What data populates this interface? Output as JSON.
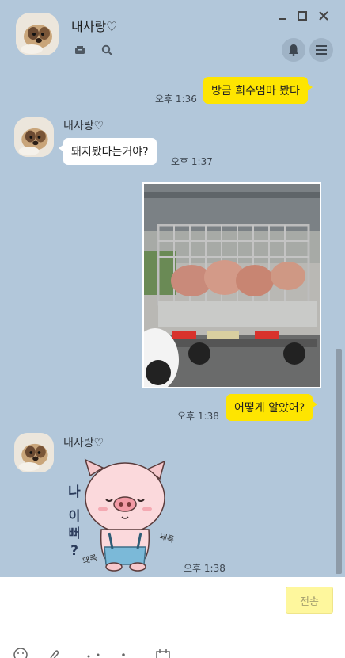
{
  "header": {
    "title": "내사랑♡",
    "window_controls": [
      "minimize-icon",
      "maximize-icon",
      "close-icon"
    ],
    "icons": [
      "drawer-icon",
      "search-icon",
      "bell-icon",
      "menu-icon"
    ]
  },
  "messages": [
    {
      "from": "me",
      "text": "방금 희수엄마 봤다",
      "time": "오후 1:36"
    },
    {
      "from": "them",
      "sender": "내사랑♡",
      "text": "돼지봤다는거야?",
      "time": "오후 1:37"
    },
    {
      "from": "me",
      "type": "photo",
      "description": "truck-with-pigs"
    },
    {
      "from": "me",
      "text": "어떻게 알았어?",
      "time": "오후 1:38"
    },
    {
      "from": "them",
      "sender": "내사랑♡",
      "type": "sticker",
      "sticker_text": [
        "나",
        "이뻐",
        "?"
      ],
      "sticker_sfx": [
        "돼륵",
        "돼륵"
      ],
      "time": "오후 1:38"
    }
  ],
  "input": {
    "placeholder": "",
    "send_label": "전송"
  },
  "toolbar": {
    "icons": [
      "emoji-icon",
      "attach-icon",
      "more-icon",
      "dots-icon",
      "calendar-icon"
    ]
  },
  "colors": {
    "background": "#b2c7da",
    "my_bubble": "#fee500",
    "their_bubble": "#ffffff",
    "send_button": "#fef79d"
  }
}
